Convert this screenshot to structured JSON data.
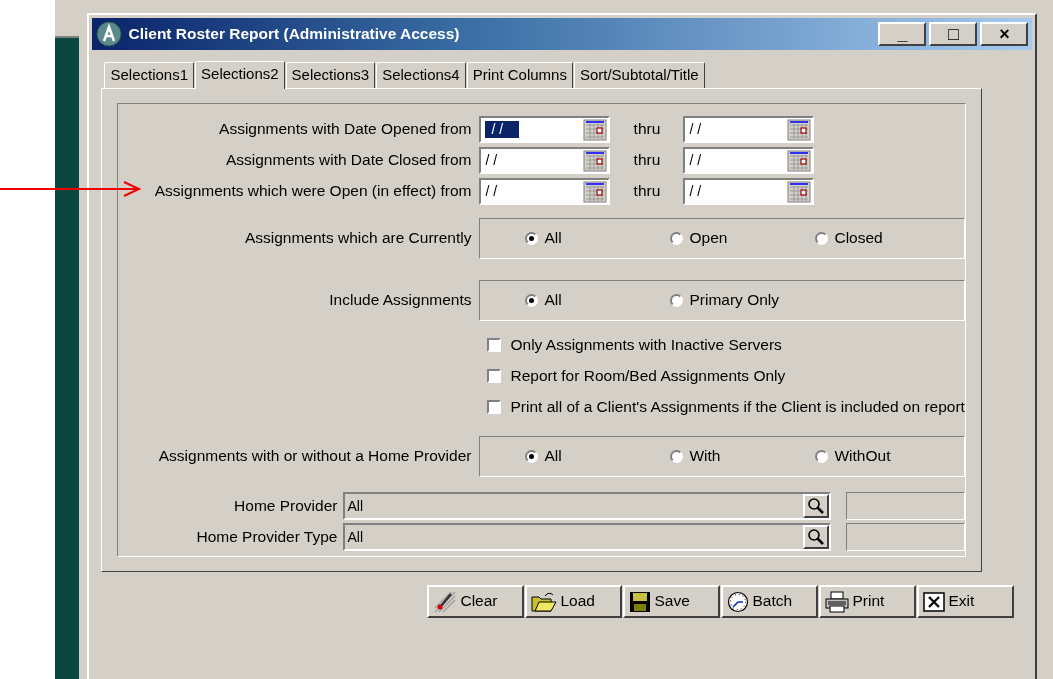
{
  "window": {
    "title": "Client Roster Report (Administrative Access)",
    "controls": [
      "_",
      "□",
      "×"
    ]
  },
  "tabs": [
    {
      "label": "Selections1",
      "selected": false
    },
    {
      "label": "Selections2",
      "selected": true
    },
    {
      "label": "Selections3",
      "selected": false
    },
    {
      "label": "Selections4",
      "selected": false
    },
    {
      "label": "Print Columns",
      "selected": false
    },
    {
      "label": "Sort/Subtotal/Title",
      "selected": false
    }
  ],
  "rows": [
    {
      "kind": "date_range",
      "label": "Assignments with Date Opened from",
      "from": "/ /",
      "from_selected": true,
      "thru": "thru",
      "to": "/ /",
      "pointer": false
    },
    {
      "kind": "date_range",
      "label": "Assignments with Date Closed from",
      "from": "/ /",
      "from_selected": false,
      "thru": "thru",
      "to": "/ /",
      "pointer": false
    },
    {
      "kind": "date_range",
      "label": "Assignments which were Open (in effect) from",
      "from": "/ /",
      "from_selected": false,
      "thru": "thru",
      "to": "/ /",
      "pointer": true
    },
    {
      "kind": "radio",
      "label": "Assignments which are Currently",
      "options": [
        {
          "label": "All",
          "selected": true
        },
        {
          "label": "Open",
          "selected": false
        },
        {
          "label": "Closed",
          "selected": false
        }
      ]
    },
    {
      "kind": "radio",
      "label": "Include Assignments",
      "options": [
        {
          "label": "All",
          "selected": true
        },
        {
          "label": "Primary Only",
          "selected": false
        }
      ]
    },
    {
      "kind": "checkbox",
      "label": "Only Assignments with Inactive Servers",
      "checked": false
    },
    {
      "kind": "checkbox",
      "label": "Report for Room/Bed Assignments Only",
      "checked": false
    },
    {
      "kind": "checkbox",
      "label": "Print all of a Client's Assignments if the Client is included on report",
      "checked": false
    },
    {
      "kind": "radio",
      "label": "Assignments with or without a Home Provider",
      "options": [
        {
          "label": "All",
          "selected": true
        },
        {
          "label": "With",
          "selected": false
        },
        {
          "label": "WithOut",
          "selected": false
        }
      ]
    },
    {
      "kind": "lookup",
      "label": "Home Provider",
      "value": "All"
    },
    {
      "kind": "lookup",
      "label": "Home Provider Type",
      "value": "All"
    }
  ],
  "buttons": [
    {
      "label": "Clear",
      "kind": "clear"
    },
    {
      "label": "Load",
      "kind": "load"
    },
    {
      "label": "Save",
      "kind": "save"
    },
    {
      "label": "Batch",
      "kind": "batch"
    },
    {
      "label": "Print",
      "kind": "print"
    },
    {
      "label": "Exit",
      "kind": "exit"
    }
  ]
}
